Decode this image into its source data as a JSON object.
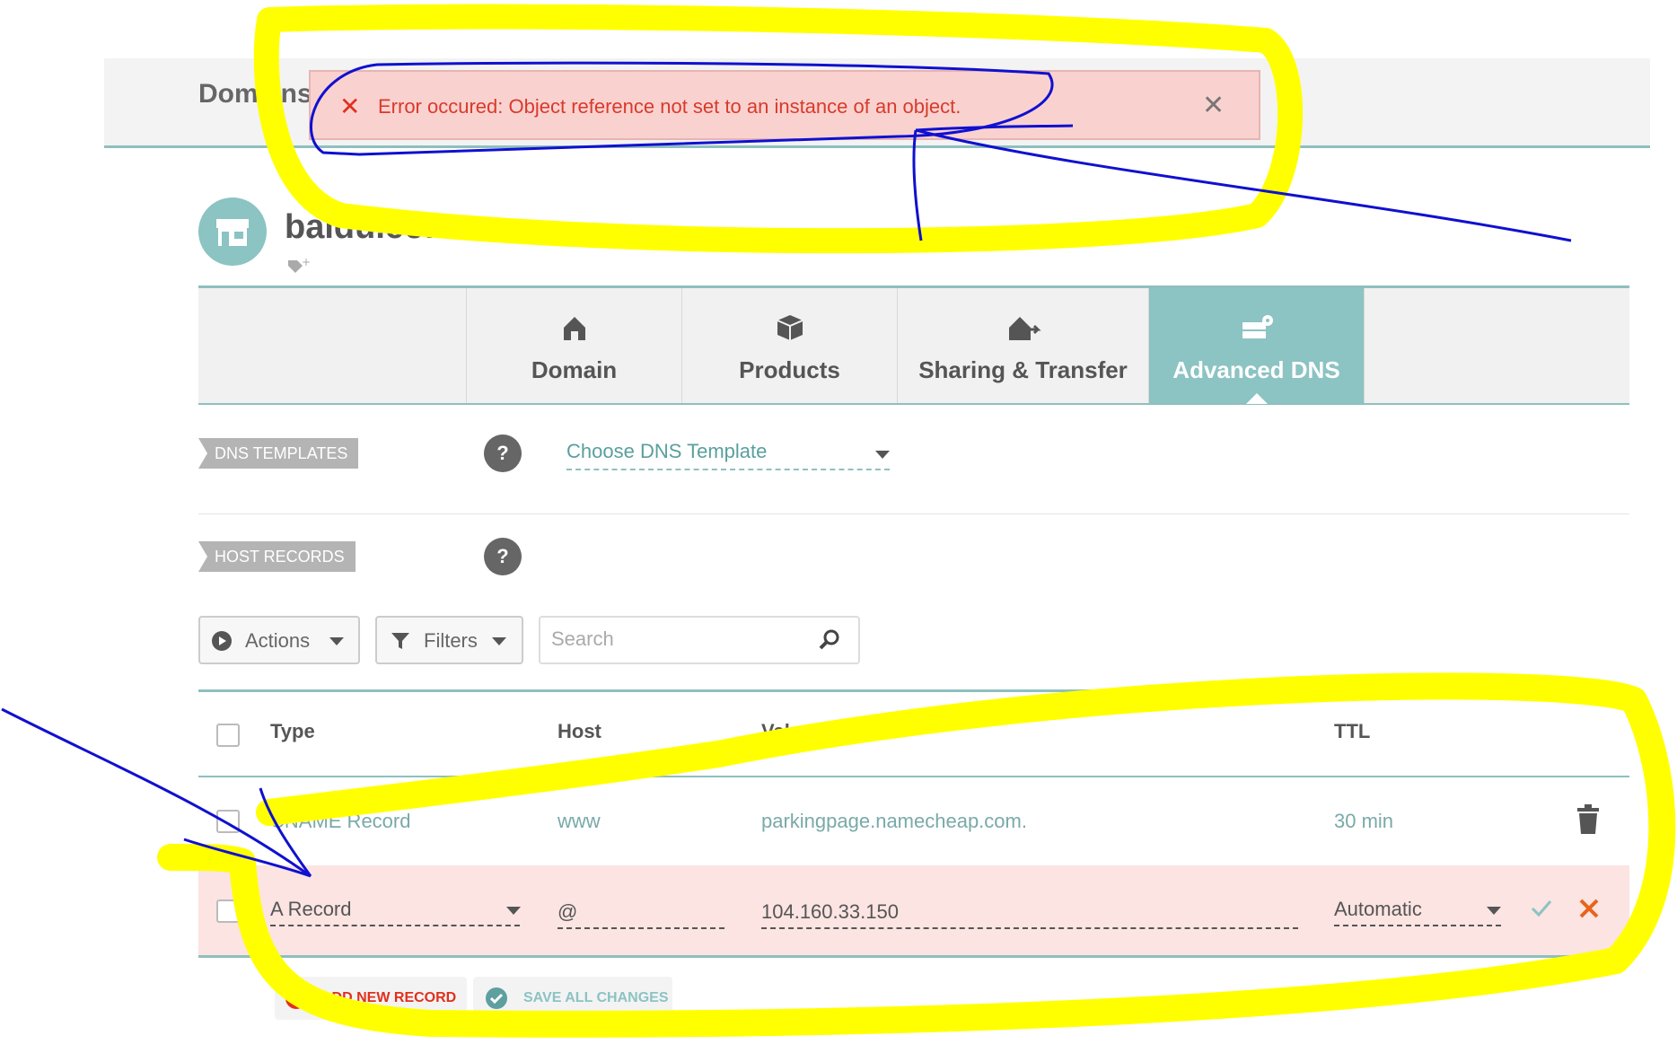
{
  "breadcrumb": "Domains",
  "error": {
    "icon": "error-x-icon",
    "message": "Error occured: Object reference not set to an instance of an object.",
    "close": "✕"
  },
  "domain": {
    "name": "baidu.com.se",
    "avatar_icon": "storefront-icon",
    "tag_icon": "add-tag-icon"
  },
  "tabs": [
    {
      "label": "Domain",
      "icon": "house-icon"
    },
    {
      "label": "Products",
      "icon": "box-icon"
    },
    {
      "label": "Sharing & Transfer",
      "icon": "house-arrow-icon"
    },
    {
      "label": "Advanced DNS",
      "icon": "server-gear-icon",
      "active": true
    }
  ],
  "dns_templates": {
    "label": "DNS TEMPLATES",
    "help": "?",
    "select_placeholder": "Choose DNS Template"
  },
  "host_records": {
    "label": "HOST RECORDS",
    "help": "?"
  },
  "toolbar": {
    "actions_label": "Actions",
    "filters_label": "Filters",
    "search_placeholder": "Search"
  },
  "table": {
    "headers": {
      "type": "Type",
      "host": "Host",
      "value": "Value",
      "ttl": "TTL"
    },
    "rows": [
      {
        "type": "CNAME Record",
        "host": "www",
        "value": "parkingpage.namecheap.com.",
        "ttl": "30 min"
      }
    ],
    "edit_row": {
      "type": "A Record",
      "host": "@",
      "value": "104.160.33.150",
      "ttl": "Automatic"
    }
  },
  "footer_actions": {
    "add_label": "ADD NEW RECORD",
    "save_label": "SAVE ALL CHANGES"
  },
  "colors": {
    "accent": "#8cc3c3",
    "error_bg": "#f9d2d0",
    "error_text": "#d93a2b",
    "highlight_yellow": "#ffff00",
    "annotation_blue": "#1010d0"
  }
}
